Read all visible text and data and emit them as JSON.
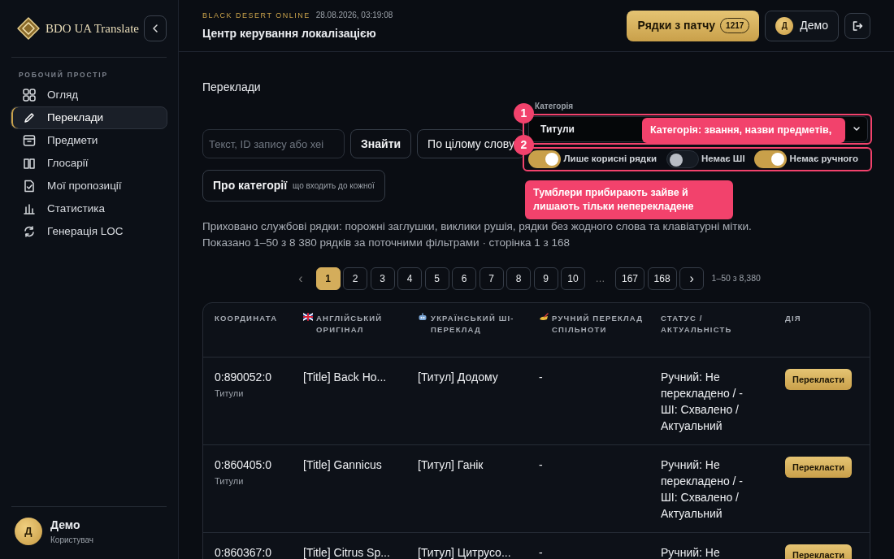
{
  "sidebar": {
    "logo": "BDO UA Translate",
    "section": "РОБОЧИЙ ПРОСТІР",
    "items": [
      {
        "label": "Огляд",
        "selected": false
      },
      {
        "label": "Переклади",
        "selected": true
      },
      {
        "label": "Предмети",
        "selected": false
      },
      {
        "label": "Глосарії",
        "selected": false
      },
      {
        "label": "Мої пропозиції",
        "selected": false
      },
      {
        "label": "Статистика",
        "selected": false
      },
      {
        "label": "Генерація LOC",
        "selected": false
      }
    ],
    "user": {
      "avatar": "Д",
      "name": "Демо",
      "role": "Користувач"
    }
  },
  "header": {
    "eyebrow": "BLACK DESERT ONLINE",
    "timestamp": "28.08.2026, 03:19:08",
    "title": "Центр керування локалізацією",
    "patch_button": "Рядки з патчу",
    "patch_count": "1217",
    "user_avatar": "Д",
    "user_name": "Демо"
  },
  "page_title": "Переклади",
  "search": {
    "placeholder": "Текст, ID запису або хеі",
    "find_button": "Знайти",
    "whole_word_button": "По цілому слову"
  },
  "about_button": {
    "label": "Про категорії",
    "hint": "що входить до кожної"
  },
  "category": {
    "label": "Категорія",
    "value": "Титули"
  },
  "toggles": [
    {
      "label": "Лише корисні рядки",
      "on": true
    },
    {
      "label": "Немає ШІ",
      "on": false
    },
    {
      "label": "Немає ручного",
      "on": true
    }
  ],
  "annotations": [
    {
      "number": "1",
      "tooltip": "Категорія: звання, назви предметів,"
    },
    {
      "number": "2",
      "tooltip": "Тумблери прибирають зайве й лишають тільки неперекладене"
    }
  ],
  "info_lines": [
    "Приховано службові рядки: порожні заглушки, виклики рушія, рядки без жодного слова та клавіатурні мітки.",
    "Показано 1–50 з 8 380 рядків за поточними фільтрами · сторінка 1 з 168"
  ],
  "pagination": {
    "prev": "‹",
    "pages": [
      {
        "label": "1",
        "selected": true
      },
      {
        "label": "2",
        "selected": false
      },
      {
        "label": "3",
        "selected": false
      },
      {
        "label": "4",
        "selected": false
      },
      {
        "label": "5",
        "selected": false
      },
      {
        "label": "6",
        "selected": false
      },
      {
        "label": "7",
        "selected": false
      },
      {
        "label": "8",
        "selected": false
      },
      {
        "label": "9",
        "selected": false
      },
      {
        "label": "10",
        "selected": false
      },
      {
        "label": "…",
        "kind": "gap",
        "selected": false
      },
      {
        "label": "167",
        "selected": false
      },
      {
        "label": "168",
        "selected": false
      }
    ],
    "next": "›",
    "range": "1–50 з 8,380"
  },
  "table": {
    "columns": [
      "КООРДИНАТА",
      "АНГЛІЙСЬКИЙ ОРИГІНАЛ",
      "УКРАЇНСЬКИЙ ШІ-ПЕРЕКЛАД",
      "РУЧНИЙ ПЕРЕКЛАД СПІЛЬНОТИ",
      "СТАТУС / АКТУАЛЬНІСТЬ",
      "ДІЯ"
    ],
    "rows": [
      {
        "coordinate": "0:890052:0",
        "category": "Титули",
        "original": "[Title] Back Ho...",
        "ai": "[Титул] Додому",
        "manual": "-",
        "status": "Ручний: Не перекладено / - ШІ: Схвалено / Актуальний",
        "action": "Перекласти"
      },
      {
        "coordinate": "0:860405:0",
        "category": "Титули",
        "original": "[Title] Gannicus",
        "ai": "[Титул] Ганік",
        "manual": "-",
        "status": "Ручний: Не перекладено / - ШІ: Схвалено / Актуальний",
        "action": "Перекласти"
      },
      {
        "coordinate": "0:860367:0",
        "original": "[Title] Citrus Sp...",
        "ai": "[Титул] Цитрусо...",
        "manual": "-",
        "status": "Ручний: Не",
        "action": "Перекласти"
      }
    ]
  }
}
